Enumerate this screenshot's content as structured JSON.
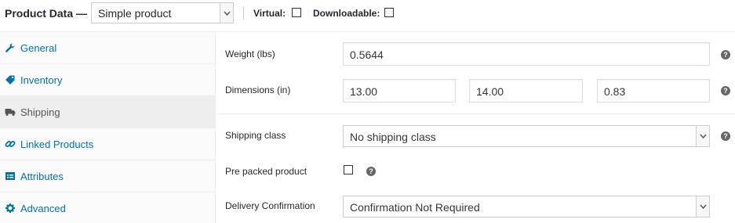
{
  "header": {
    "title": "Product Data —",
    "product_type": "Simple product",
    "virtual_label": "Virtual:",
    "downloadable_label": "Downloadable:"
  },
  "tabs": [
    {
      "label": "General",
      "icon": "wrench-icon"
    },
    {
      "label": "Inventory",
      "icon": "tag-icon"
    },
    {
      "label": "Shipping",
      "icon": "truck-icon",
      "active": true
    },
    {
      "label": "Linked Products",
      "icon": "link-icon"
    },
    {
      "label": "Attributes",
      "icon": "list-icon"
    },
    {
      "label": "Advanced",
      "icon": "gear-icon"
    }
  ],
  "shipping": {
    "weight_label": "Weight (lbs)",
    "weight_value": "0.5644",
    "dimensions_label": "Dimensions (in)",
    "length": "13.00",
    "width": "14.00",
    "height": "0.83",
    "shipping_class_label": "Shipping class",
    "shipping_class_value": "No shipping class",
    "pre_packed_label": "Pre packed product",
    "delivery_label": "Delivery Confirmation",
    "delivery_value": "Confirmation Not Required",
    "help_glyph": "?"
  },
  "colors": {
    "link": "#0073aa",
    "active_tab_bg": "#eeeeee",
    "sidebar_bg": "#fafafa"
  }
}
